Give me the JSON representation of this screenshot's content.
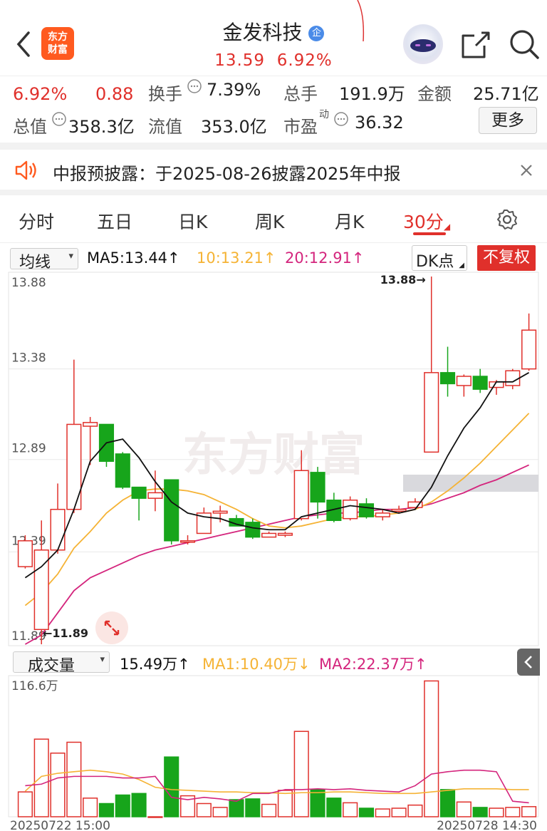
{
  "header": {
    "title": "金发科技",
    "badge": "企",
    "price": "13.59",
    "change_pct": "6.92%",
    "app_logo_line1": "东方",
    "app_logo_line2": "财富"
  },
  "quote": {
    "pct": "6.92%",
    "change": "0.88",
    "turnover_label": "换手",
    "turnover": "7.39%",
    "volume_label": "总手",
    "volume": "191.9万",
    "amount_label": "金额",
    "amount": "25.71亿",
    "mktcap_label": "总值",
    "mktcap": "358.3亿",
    "float_label": "流值",
    "float": "353.0亿",
    "pe_label": "市盈",
    "pe_sup": "动",
    "pe": "36.32",
    "more": "更多"
  },
  "notice": {
    "text": "中报预披露：于2025-08-26披露2025年中报"
  },
  "tabs": [
    "分时",
    "五日",
    "日K",
    "周K",
    "月K",
    "30分"
  ],
  "active_tab": 5,
  "kline": {
    "indicator_select": "均线",
    "ma5": "MA5:13.44↑",
    "ma10": "10:13.21↑",
    "ma20": "20:12.91↑",
    "dk_label": "DK点",
    "fq_label": "不复权",
    "y_labels": [
      "13.88",
      "13.38",
      "12.89",
      "12.39",
      "11.89"
    ],
    "high_label": "13.88→",
    "low_label": "11.89",
    "watermark": "东方财富"
  },
  "volume": {
    "indicator_select": "成交量",
    "value": "15.49万↑",
    "ma1": "MA1:10.40万↓",
    "ma2": "MA2:22.37万↑",
    "max_label": "116.6万",
    "date_start": "20250722 15:00",
    "date_end": "20250728 14:30"
  },
  "colors": {
    "up": "#e0302b",
    "down": "#17a51b",
    "ma5": "#111111",
    "ma10": "#f5b335",
    "ma20": "#d4257d"
  },
  "chart_data": {
    "type": "candlestick",
    "ylim": [
      11.89,
      13.88
    ],
    "candles": [
      {
        "o": 12.31,
        "c": 12.45,
        "h": 12.48,
        "l": 12.3
      },
      {
        "o": 11.97,
        "c": 12.4,
        "h": 12.56,
        "l": 11.89
      },
      {
        "o": 12.4,
        "c": 12.62,
        "h": 12.76,
        "l": 12.38
      },
      {
        "o": 12.62,
        "c": 13.08,
        "h": 13.43,
        "l": 12.6
      },
      {
        "o": 13.07,
        "c": 13.09,
        "h": 13.12,
        "l": 12.86
      },
      {
        "o": 13.08,
        "c": 12.88,
        "h": 13.08,
        "l": 12.85
      },
      {
        "o": 12.92,
        "c": 12.74,
        "h": 12.93,
        "l": 12.73
      },
      {
        "o": 12.74,
        "c": 12.68,
        "h": 12.74,
        "l": 12.56
      },
      {
        "o": 12.68,
        "c": 12.71,
        "h": 12.83,
        "l": 12.61
      },
      {
        "o": 12.78,
        "c": 12.45,
        "h": 12.78,
        "l": 12.43
      },
      {
        "o": 12.45,
        "c": 12.45,
        "h": 12.48,
        "l": 12.43
      },
      {
        "o": 12.49,
        "c": 12.6,
        "h": 12.63,
        "l": 12.49
      },
      {
        "o": 12.6,
        "c": 12.61,
        "h": 12.64,
        "l": 12.55
      },
      {
        "o": 12.57,
        "c": 12.53,
        "h": 12.59,
        "l": 12.53
      },
      {
        "o": 12.55,
        "c": 12.47,
        "h": 12.57,
        "l": 12.46
      },
      {
        "o": 12.47,
        "c": 12.49,
        "h": 12.5,
        "l": 12.47
      },
      {
        "o": 12.48,
        "c": 12.49,
        "h": 12.5,
        "l": 12.47
      },
      {
        "o": 12.57,
        "c": 12.83,
        "h": 12.94,
        "l": 12.56
      },
      {
        "o": 12.82,
        "c": 12.66,
        "h": 12.85,
        "l": 12.57
      },
      {
        "o": 12.67,
        "c": 12.56,
        "h": 12.71,
        "l": 12.55
      },
      {
        "o": 12.57,
        "c": 12.67,
        "h": 12.69,
        "l": 12.56
      },
      {
        "o": 12.65,
        "c": 12.58,
        "h": 12.68,
        "l": 12.57
      },
      {
        "o": 12.58,
        "c": 12.6,
        "h": 12.62,
        "l": 12.56
      },
      {
        "o": 12.61,
        "c": 12.62,
        "h": 12.64,
        "l": 12.6
      },
      {
        "o": 12.63,
        "c": 12.66,
        "h": 12.68,
        "l": 12.62
      },
      {
        "o": 12.93,
        "c": 13.36,
        "h": 13.88,
        "l": 12.93
      },
      {
        "o": 13.36,
        "c": 13.3,
        "h": 13.5,
        "l": 13.23
      },
      {
        "o": 13.29,
        "c": 13.34,
        "h": 13.35,
        "l": 13.23
      },
      {
        "o": 13.34,
        "c": 13.27,
        "h": 13.38,
        "l": 13.25
      },
      {
        "o": 13.28,
        "c": 13.31,
        "h": 13.32,
        "l": 13.24
      },
      {
        "o": 13.29,
        "c": 13.37,
        "h": 13.38,
        "l": 13.27
      },
      {
        "o": 13.38,
        "c": 13.59,
        "h": 13.68,
        "l": 13.37
      }
    ],
    "ma5_line": [
      12.25,
      12.31,
      12.4,
      12.62,
      12.88,
      12.98,
      13.0,
      12.9,
      12.77,
      12.66,
      12.6,
      12.58,
      12.57,
      12.54,
      12.52,
      12.51,
      12.51,
      12.58,
      12.6,
      12.62,
      12.64,
      12.63,
      12.62,
      12.6,
      12.62,
      12.74,
      12.91,
      13.06,
      13.17,
      13.31,
      13.31,
      13.36
    ],
    "ma10_line": [
      12.1,
      12.17,
      12.27,
      12.41,
      12.5,
      12.6,
      12.67,
      12.72,
      12.73,
      12.73,
      12.72,
      12.7,
      12.66,
      12.62,
      12.57,
      12.53,
      12.52,
      12.53,
      12.55,
      12.57,
      12.58,
      12.58,
      12.59,
      12.6,
      12.62,
      12.66,
      12.72,
      12.79,
      12.87,
      12.96,
      13.05,
      13.14
    ],
    "ma20_line": [
      11.89,
      11.94,
      12.06,
      12.18,
      12.25,
      12.29,
      12.33,
      12.37,
      12.4,
      12.42,
      12.44,
      12.46,
      12.48,
      12.5,
      12.52,
      12.54,
      12.56,
      12.58,
      12.59,
      12.6,
      12.6,
      12.61,
      12.62,
      12.62,
      12.63,
      12.65,
      12.68,
      12.71,
      12.75,
      12.78,
      12.82,
      12.86
    ],
    "volumes": [
      0.32,
      1.0,
      0.82,
      0.96,
      0.24,
      0.17,
      0.28,
      0.3,
      0.0,
      0.77,
      0.27,
      0.17,
      0.12,
      0.22,
      0.23,
      0.16,
      0.34,
      1.1,
      0.35,
      0.24,
      0.18,
      0.11,
      0.1,
      0.11,
      0.15,
      1.75,
      0.35,
      0.19,
      0.12,
      0.11,
      0.12,
      0.13
    ],
    "vol_ma1": [
      0.33,
      0.52,
      0.56,
      0.58,
      0.6,
      0.58,
      0.55,
      0.48,
      0.38,
      0.35,
      0.34,
      0.33,
      0.32,
      0.32,
      0.31,
      0.31,
      0.3,
      0.31,
      0.31,
      0.32,
      0.32,
      0.31,
      0.3,
      0.3,
      0.3,
      0.32,
      0.34,
      0.36,
      0.36,
      0.36,
      0.35,
      0.35
    ],
    "vol_ma2": [
      0.4,
      0.42,
      0.5,
      0.52,
      0.52,
      0.52,
      0.5,
      0.5,
      0.52,
      0.25,
      0.22,
      0.25,
      0.23,
      0.2,
      0.3,
      0.3,
      0.35,
      0.35,
      0.36,
      0.35,
      0.36,
      0.34,
      0.33,
      0.32,
      0.4,
      0.55,
      0.58,
      0.6,
      0.6,
      0.58,
      0.2,
      0.18
    ]
  }
}
